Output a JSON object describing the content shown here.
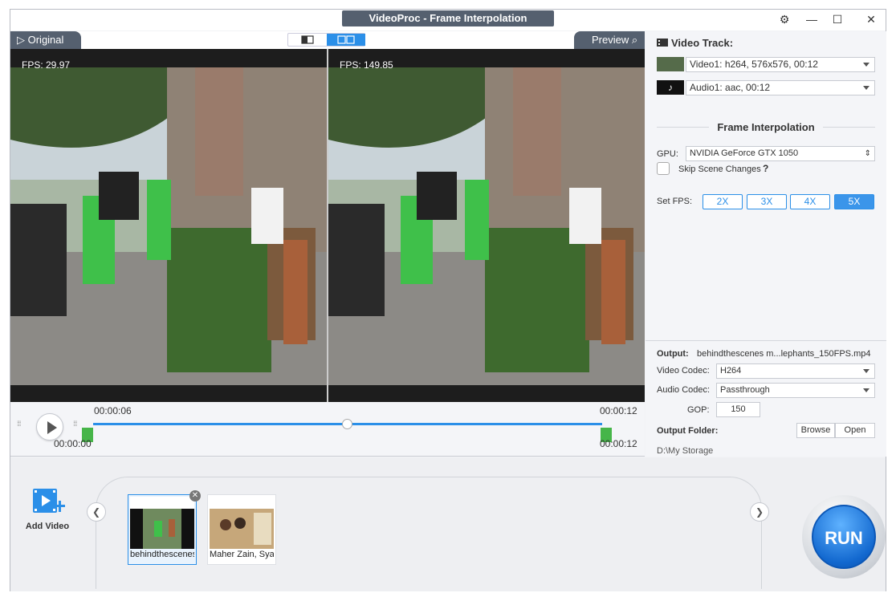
{
  "window": {
    "title": "VideoProc - Frame Interpolation"
  },
  "preview": {
    "original_tab": "Original",
    "preview_tab": "Preview",
    "left_fps": "FPS: 29.97",
    "right_fps": "FPS: 149.85"
  },
  "timeline": {
    "current_time": "00:00:06",
    "start_time": "00:00:00",
    "end_time_top": "00:00:12",
    "end_time_bottom": "00:00:12",
    "playhead_fraction": 0.5
  },
  "right_panel": {
    "video_track_title": "Video Track:",
    "video_stream": "Video1: h264, 576x576, 00:12",
    "audio_stream": "Audio1: aac, 00:12",
    "section_title": "Frame Interpolation",
    "gpu_label": "GPU:",
    "gpu_value": "NVIDIA GeForce GTX 1050",
    "skip_scene_label": "Skip Scene Changes",
    "help_mark": "?",
    "set_fps_label": "Set FPS:",
    "fps_options": [
      "2X",
      "3X",
      "4X",
      "5X"
    ],
    "fps_selected": "5X",
    "output_label": "Output:",
    "output_value": "behindthescenes m...lephants_150FPS.mp4",
    "video_codec_label": "Video Codec:",
    "video_codec_value": "H264",
    "audio_codec_label": "Audio Codec:",
    "audio_codec_value": "Passthrough",
    "gop_label": "GOP:",
    "gop_value": "150",
    "output_folder_label": "Output Folder:",
    "browse_label": "Browse",
    "open_label": "Open",
    "folder_path": "D:\\My Storage"
  },
  "bottom": {
    "add_video_label": "Add Video",
    "thumbnails": [
      {
        "name": "behindthescenes"
      },
      {
        "name": "Maher Zain, Syak"
      }
    ],
    "run_label": "RUN"
  },
  "colors": {
    "accent": "#2b8fe8",
    "flag": "#46b549",
    "header_tab": "#55606f"
  }
}
